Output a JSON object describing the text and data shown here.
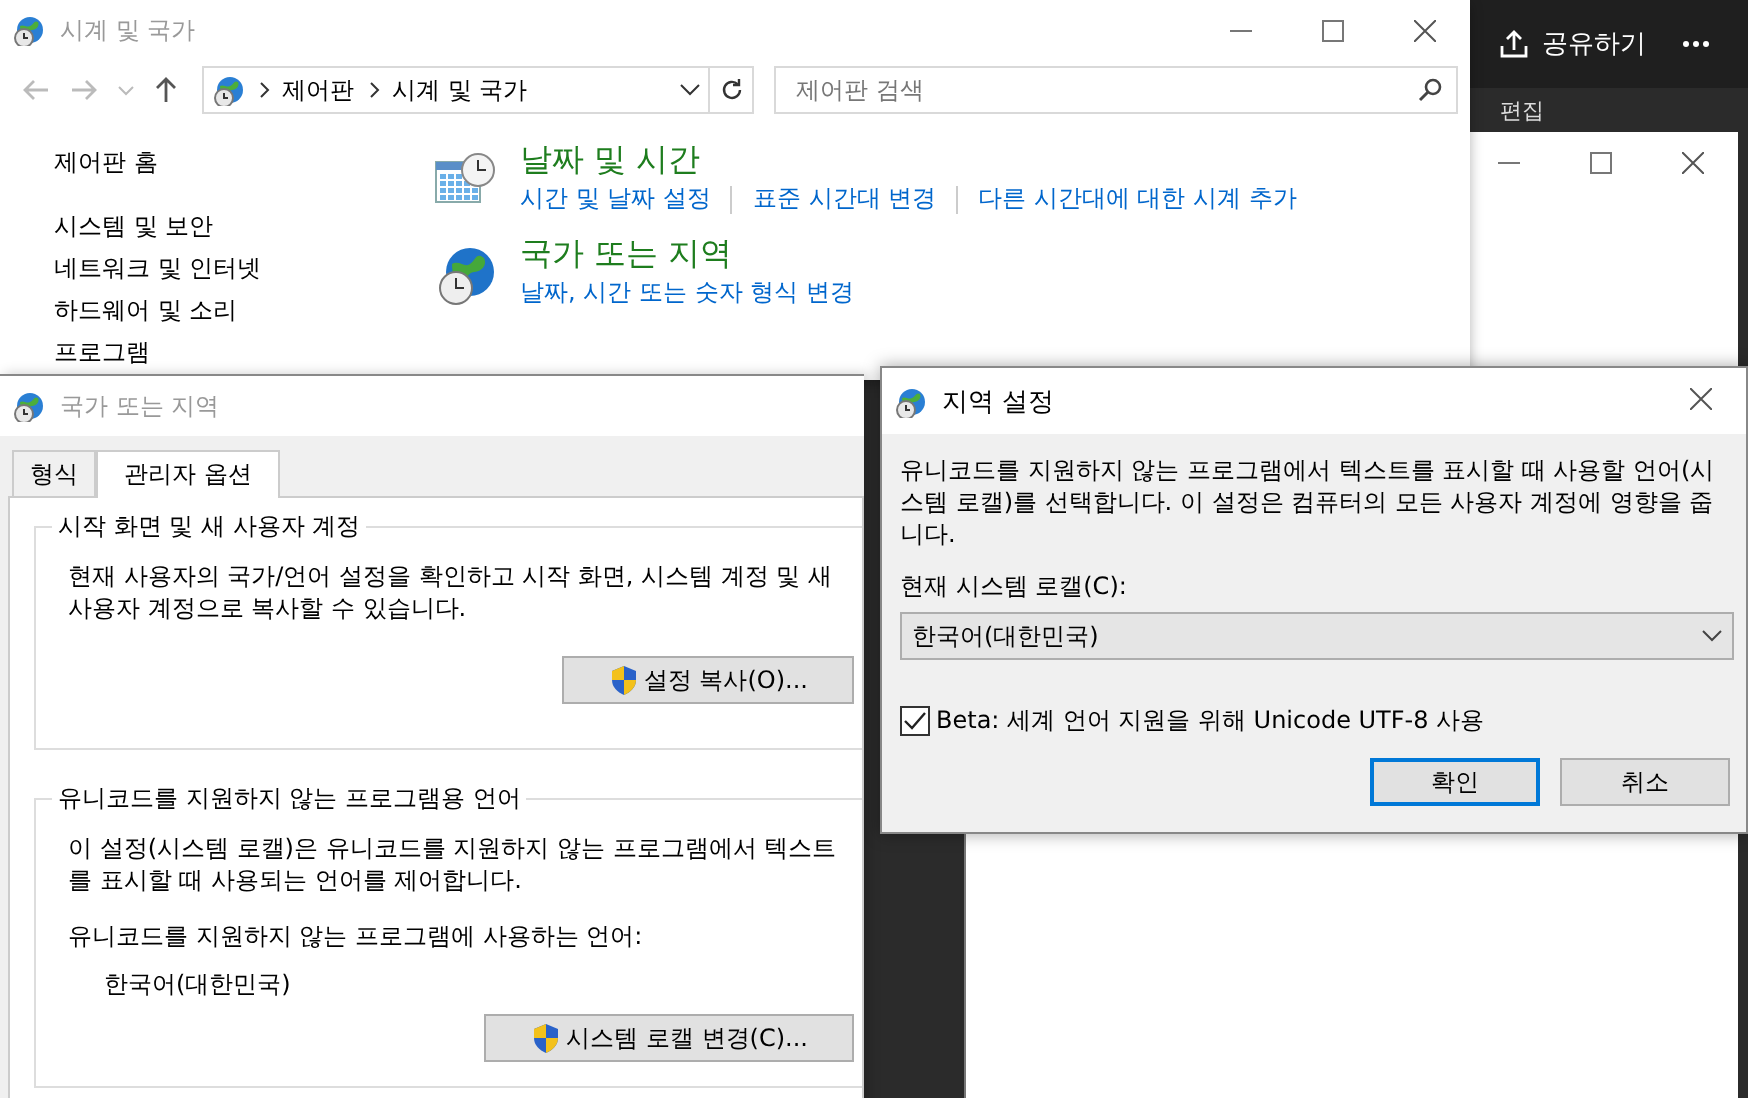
{
  "control_panel": {
    "title": "시계 및 국가",
    "breadcrumb": [
      "제어판",
      "시계 및 국가"
    ],
    "search": {
      "placeholder": "제어판 검색"
    },
    "nav": [
      "제어판 홈",
      "시스템 및 보안",
      "네트워크 및 인터넷",
      "하드웨어 및 소리",
      "프로그램"
    ],
    "categories": [
      {
        "kind": "clock",
        "title": "날짜 및 시간",
        "links": [
          "시간 및 날짜 설정",
          "표준 시간대 변경",
          "다른 시간대에 대한 시계 추가"
        ]
      },
      {
        "kind": "globe",
        "title": "국가 또는 지역",
        "links": [
          "날짜, 시간 또는 숫자 형식 변경"
        ]
      }
    ]
  },
  "background_app": {
    "share": "공유하기",
    "edit": "편집"
  },
  "region_dialog": {
    "title": "국가 또는 지역",
    "tabs": [
      {
        "label": "형식",
        "selected": false
      },
      {
        "label": "관리자 옵션",
        "selected": true
      }
    ],
    "groups": [
      {
        "title": "시작 화면 및 새 사용자 계정",
        "description": "현재 사용자의 국가/언어 설정을 확인하고 시작 화면, 시스템 계정 및 새 사용자 계정으로 복사할 수 있습니다.",
        "button": "설정 복사(O)..."
      },
      {
        "title": "유니코드를 지원하지 않는 프로그램용 언어",
        "description": "이 설정(시스템 로캘)은 유니코드를 지원하지 않는 프로그램에서 텍스트를 표시할 때 사용되는 언어를 제어합니다.",
        "label": "유니코드를 지원하지 않는 프로그램에 사용하는 언어:",
        "value": "한국어(대한민국)",
        "button": "시스템 로캘 변경(C)..."
      }
    ]
  },
  "locale_dialog": {
    "title": "지역 설정",
    "description": "유니코드를 지원하지 않는 프로그램에서 텍스트를 표시할 때 사용할 언어(시스템 로캘)를 선택합니다. 이 설정은 컴퓨터의 모든 사용자 계정에 영향을 줍니다.",
    "field_label": "현재 시스템 로캘(C):",
    "dropdown": "한국어(대한민국)",
    "beta": {
      "label": "Beta: 세계 언어 지원을 위해 Unicode UTF-8 사용",
      "checked": true
    },
    "buttons": [
      {
        "label": "확인",
        "default": true
      },
      {
        "label": "취소",
        "default": false
      }
    ]
  }
}
